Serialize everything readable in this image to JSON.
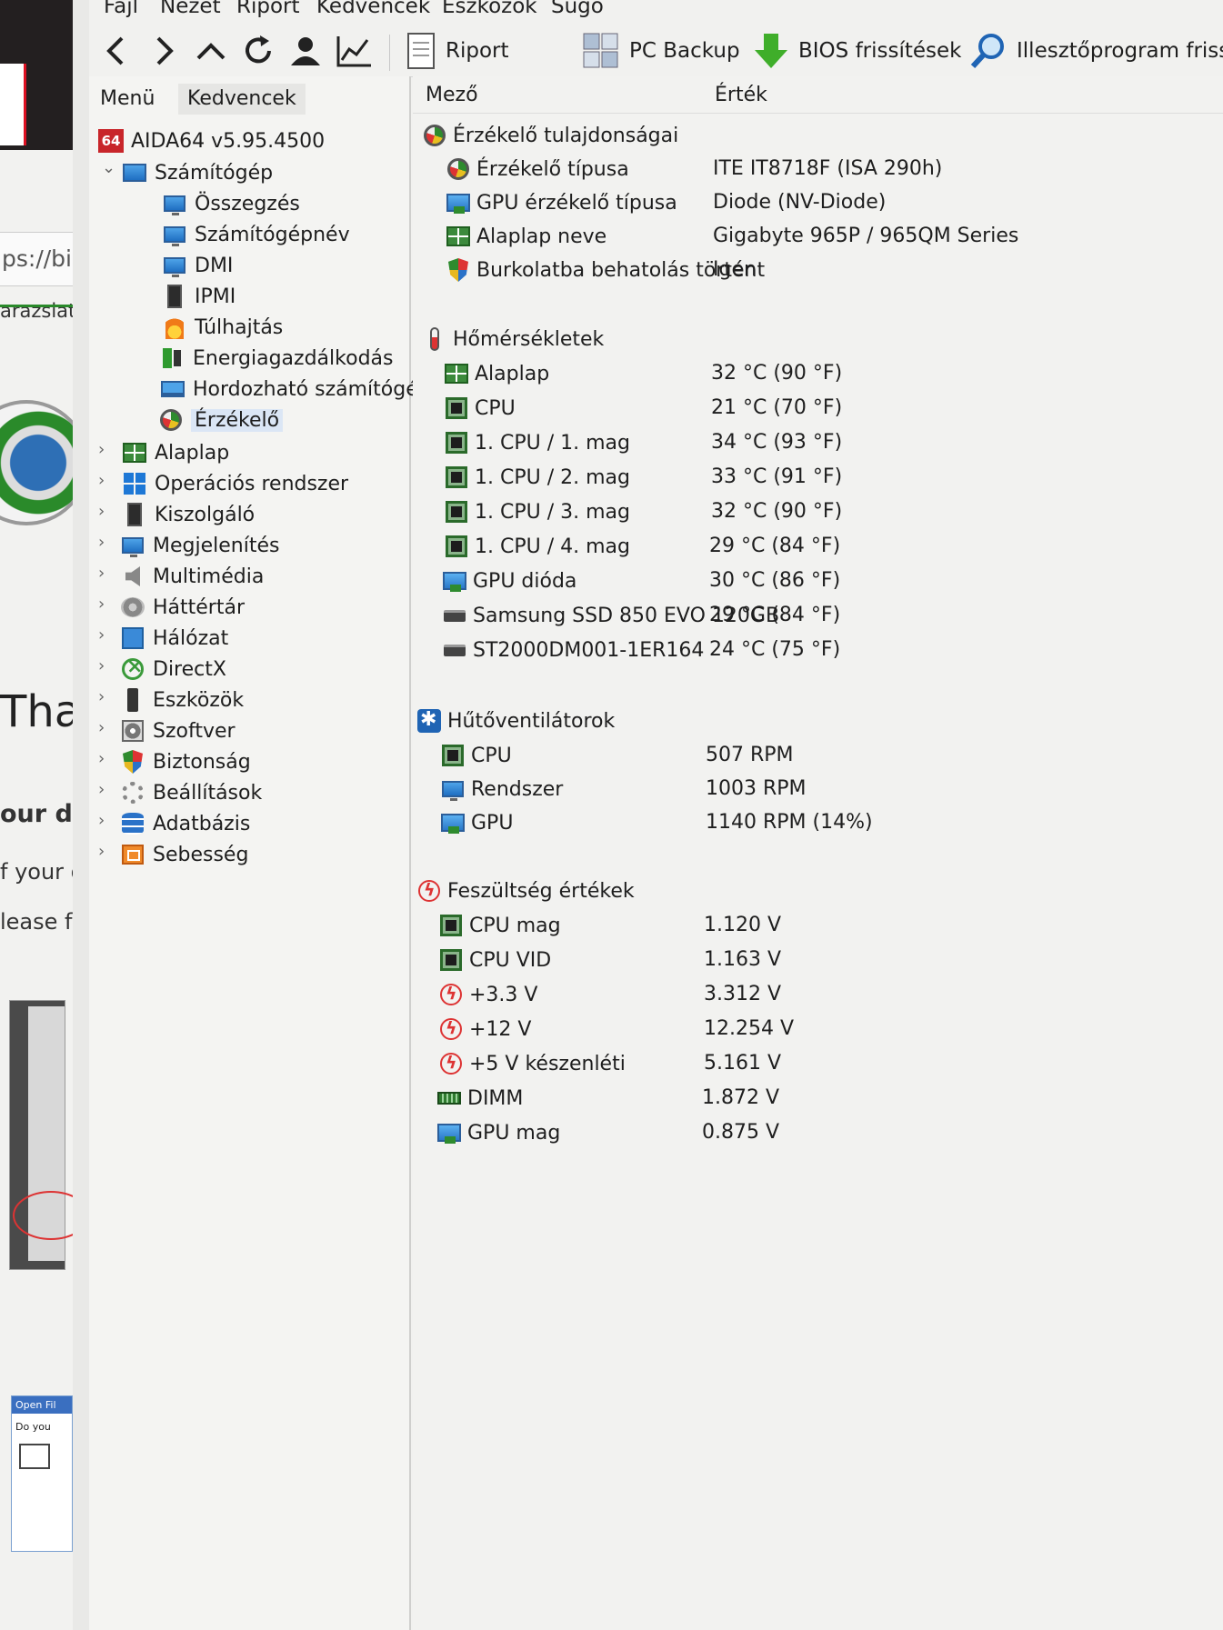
{
  "menubar": [
    "Fájl",
    "Nézet",
    "Riport",
    "Kedvencek",
    "Eszközök",
    "Súgó"
  ],
  "toolbar": {
    "report": "Riport",
    "pc_backup": "PC Backup",
    "bios_updates": "BIOS frissítések",
    "driver_updates": "Illesztőprogram frissí"
  },
  "left_tabs": {
    "menu": "Menü",
    "favorites": "Kedvencek"
  },
  "tree": {
    "root": "AIDA64 v5.95.4500",
    "computer": "Számítógép",
    "computer_children": [
      "Összegzés",
      "Számítógépnév",
      "DMI",
      "IPMI",
      "Túlhajtás",
      "Energiagazdálkodás",
      "Hordozható számítógé",
      "Érzékelő"
    ],
    "top_items": [
      "Alaplap",
      "Operációs rendszer",
      "Kiszolgáló",
      "Megjelenítés",
      "Multimédia",
      "Háttértár",
      "Hálózat",
      "DirectX",
      "Eszközök",
      "Szoftver",
      "Biztonság",
      "Beállítások",
      "Adatbázis",
      "Sebesség"
    ]
  },
  "columns": {
    "field": "Mező",
    "value": "Érték"
  },
  "sections": {
    "sensor": {
      "title": "Érzékelő tulajdonságai",
      "rows": [
        {
          "field": "Érzékelő típusa",
          "value": "ITE IT8718F  (ISA 290h)"
        },
        {
          "field": "GPU érzékelő típusa",
          "value": "Diode  (NV-Diode)"
        },
        {
          "field": "Alaplap neve",
          "value": "Gigabyte 965P / 965QM Series"
        },
        {
          "field": "Burkolatba behatolás történt",
          "value": "Igen"
        }
      ]
    },
    "temps": {
      "title": "Hőmérsékletek",
      "rows": [
        {
          "field": "Alaplap",
          "value": "32 °C  (90 °F)"
        },
        {
          "field": "CPU",
          "value": "21 °C  (70 °F)"
        },
        {
          "field": "1. CPU / 1. mag",
          "value": "34 °C  (93 °F)"
        },
        {
          "field": "1. CPU / 2. mag",
          "value": "33 °C  (91 °F)"
        },
        {
          "field": "1. CPU / 3. mag",
          "value": "32 °C  (90 °F)"
        },
        {
          "field": "1. CPU / 4. mag",
          "value": "29 °C  (84 °F)"
        },
        {
          "field": "GPU dióda",
          "value": "30 °C  (86 °F)"
        },
        {
          "field": "Samsung SSD 850 EVO 120GB",
          "value": "29 °C  (84 °F)"
        },
        {
          "field": "ST2000DM001-1ER164",
          "value": "24 °C  (75 °F)"
        }
      ]
    },
    "fans": {
      "title": "Hűtőventilátorok",
      "rows": [
        {
          "field": "CPU",
          "value": "507 RPM"
        },
        {
          "field": "Rendszer",
          "value": "1003 RPM"
        },
        {
          "field": "GPU",
          "value": "1140 RPM  (14%)"
        }
      ]
    },
    "volts": {
      "title": "Feszültség értékek",
      "rows": [
        {
          "field": "CPU mag",
          "value": "1.120 V"
        },
        {
          "field": "CPU VID",
          "value": "1.163 V"
        },
        {
          "field": "+3.3 V",
          "value": "3.312 V"
        },
        {
          "field": "+12 V",
          "value": "12.254 V"
        },
        {
          "field": "+5 V készenléti",
          "value": "5.161 V"
        },
        {
          "field": "DIMM",
          "value": "1.872 V"
        },
        {
          "field": "GPU mag",
          "value": "0.875 V"
        }
      ]
    }
  },
  "background_page": {
    "url_fragment": "ps://bios",
    "tab_fragment": "arazslato",
    "heading_fragment": "Thar",
    "line1": "our do",
    "line2": "f your d",
    "line3": "lease fo",
    "dialog_title": "Open Fil",
    "dialog_body": "Do you"
  }
}
